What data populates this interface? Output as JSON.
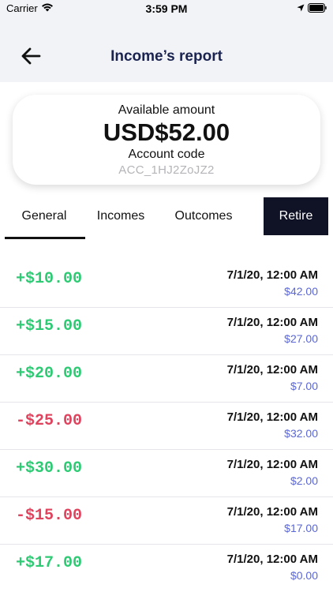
{
  "status_bar": {
    "carrier": "Carrier",
    "time": "3:59 PM"
  },
  "nav": {
    "title": "Income’s report"
  },
  "balance": {
    "label": "Available amount",
    "amount": "USD$52.00",
    "account_label": "Account code",
    "account_code": "ACC_1HJ2ZoJZ2"
  },
  "tabs": [
    {
      "label": "General"
    },
    {
      "label": "Incomes"
    },
    {
      "label": "Outcomes"
    },
    {
      "label": "Retire"
    }
  ],
  "transactions": [
    {
      "amount": "+$10.00",
      "date": "7/1/20, 12:00 AM",
      "balance": "$42.00"
    },
    {
      "amount": "+$15.00",
      "date": "7/1/20, 12:00 AM",
      "balance": "$27.00"
    },
    {
      "amount": "+$20.00",
      "date": "7/1/20, 12:00 AM",
      "balance": "$7.00"
    },
    {
      "amount": "-$25.00",
      "date": "7/1/20, 12:00 AM",
      "balance": "$32.00"
    },
    {
      "amount": "+$30.00",
      "date": "7/1/20, 12:00 AM",
      "balance": "$2.00"
    },
    {
      "amount": "-$15.00",
      "date": "7/1/20, 12:00 AM",
      "balance": "$17.00"
    },
    {
      "amount": "+$17.00",
      "date": "7/1/20, 12:00 AM",
      "balance": "$0.00"
    }
  ],
  "colors": {
    "positive": "#2fcb74",
    "negative": "#e0435d",
    "balance_text": "#5a67d8",
    "title_text": "#1b2350",
    "retire_bg": "#0f1325"
  },
  "icons": {
    "wifi": "wifi-icon",
    "location": "location-arrow-icon",
    "battery": "battery-icon",
    "back": "arrow-left-icon"
  }
}
